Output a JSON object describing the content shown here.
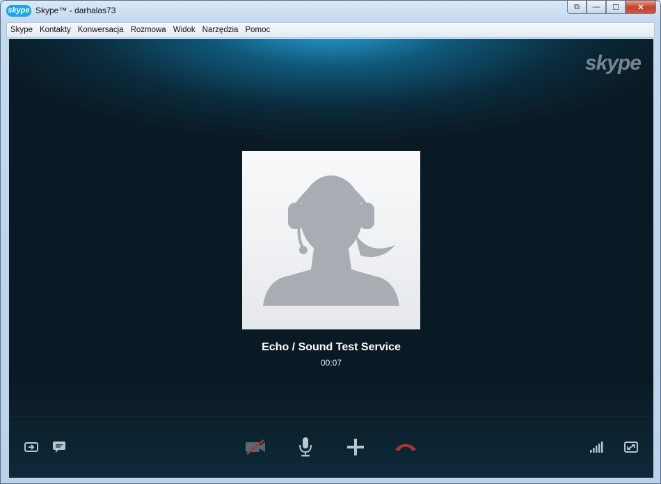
{
  "window": {
    "logo_text": "skype",
    "title": "Skype™ - darhalas73",
    "controls": {
      "restore": "⧉",
      "minimize": "—",
      "maximize": "☐",
      "close": "✕"
    }
  },
  "menu": [
    "Skype",
    "Kontakty",
    "Konwersacja",
    "Rozmowa",
    "Widok",
    "Narzędzia",
    "Pomoc"
  ],
  "call": {
    "watermark": "skype",
    "contact_name": "Echo / Sound Test Service",
    "duration": "00:07"
  },
  "colors": {
    "hangup": "#e0301e",
    "accent": "#1aa6e8"
  }
}
